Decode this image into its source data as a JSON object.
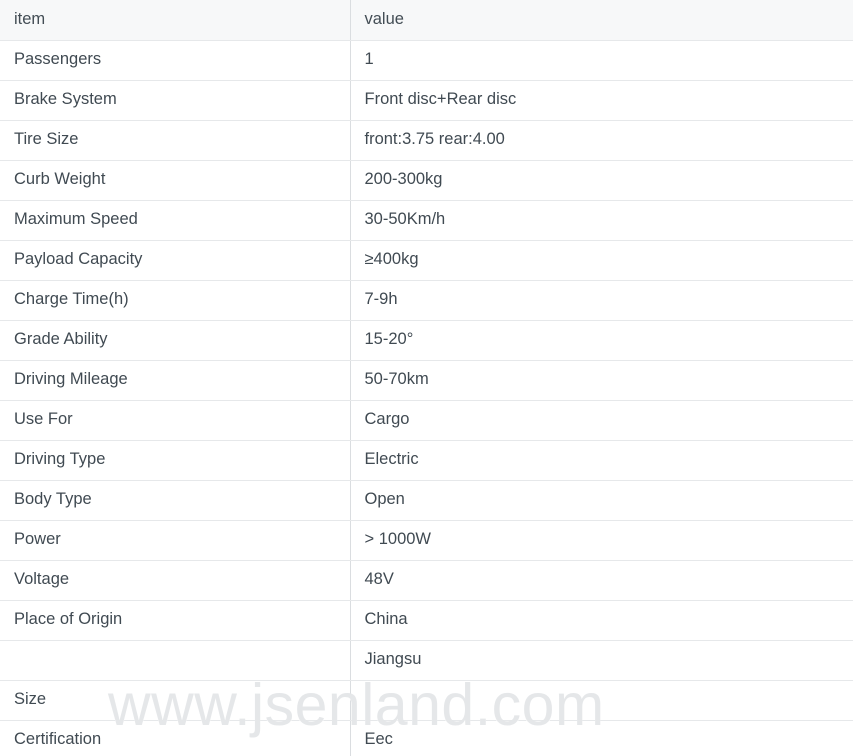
{
  "table": {
    "headers": {
      "item": "item",
      "value": "value"
    },
    "rows": [
      {
        "item": "Passengers",
        "value": "1"
      },
      {
        "item": "Brake System",
        "value": "Front disc+Rear disc"
      },
      {
        "item": "Tire Size",
        "value": "front:3.75 rear:4.00"
      },
      {
        "item": "Curb Weight",
        "value": "200-300kg"
      },
      {
        "item": "Maximum Speed",
        "value": "30-50Km/h"
      },
      {
        "item": "Payload Capacity",
        "value": "≥400kg"
      },
      {
        "item": "Charge Time(h)",
        "value": "7-9h"
      },
      {
        "item": "Grade Ability",
        "value": "15-20°"
      },
      {
        "item": "Driving Mileage",
        "value": "50-70km"
      },
      {
        "item": "Use For",
        "value": "Cargo"
      },
      {
        "item": "Driving Type",
        "value": "Electric"
      },
      {
        "item": "Body Type",
        "value": "Open"
      },
      {
        "item": "Power",
        "value": "> 1000W"
      },
      {
        "item": "Voltage",
        "value": "48V"
      },
      {
        "item": "Place of Origin",
        "value": "China"
      },
      {
        "item": "",
        "value": "Jiangsu"
      },
      {
        "item": "Size",
        "value": ""
      },
      {
        "item": "Certification",
        "value": "Eec"
      }
    ]
  },
  "watermark": {
    "text": "www.jsenland.com"
  },
  "colors": {
    "text": "#404a52",
    "header_background": "#f7f8f9",
    "row_border": "#e6e8ea",
    "column_border": "#dadde0",
    "watermark": "#e3e5e7"
  }
}
